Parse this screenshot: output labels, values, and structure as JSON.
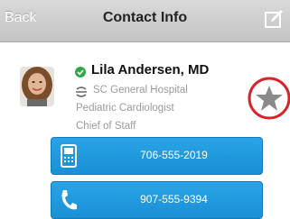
{
  "nav": {
    "back_label": "Back",
    "title": "Contact Info"
  },
  "contact": {
    "name": "Lila Andersen, MD",
    "hospital": "SC General Hospital",
    "specialty": "Pediatric Cardiologist",
    "role": "Chief of Staff",
    "verified": true
  },
  "phones": [
    {
      "type": "mobile-phone-icon",
      "number": "706-555-2019"
    },
    {
      "type": "phone-handset-icon",
      "number": "907-555-9394"
    }
  ],
  "colors": {
    "accent": "#1a8fd6",
    "favorite_ring": "#d8232a",
    "verified": "#2ea84a"
  }
}
